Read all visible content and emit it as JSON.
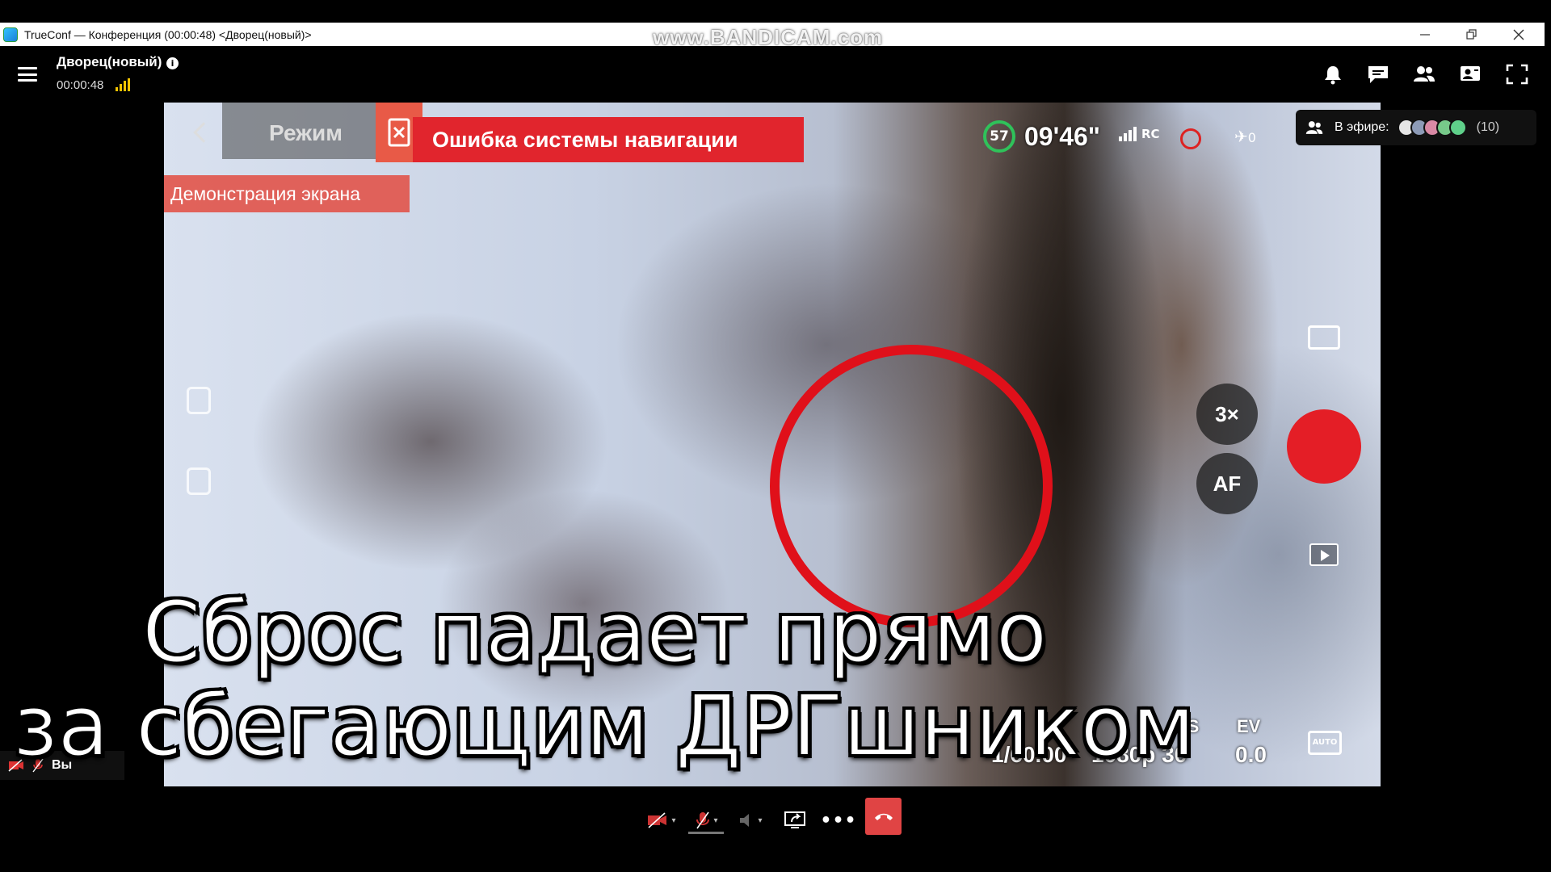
{
  "window": {
    "title": "TrueConf — Конференция (00:00:48) <Дворец(новый)>",
    "watermark": "www.BANDICAM.com"
  },
  "header": {
    "conference_name": "Дворец(новый)",
    "elapsed": "00:00:48",
    "icons": [
      "menu-icon",
      "info-icon",
      "signal-icon",
      "bell-icon",
      "chat-icon",
      "participants-icon",
      "content-icon",
      "fullscreen-icon"
    ]
  },
  "shared_screen": {
    "screen_share_label": "Демонстрация экрана",
    "mode_label": "Режим",
    "nav_error": "Ошибка системы навигации",
    "battery": "57",
    "flight_time": "09'46\"",
    "rc_label": "RC",
    "satellites": "0",
    "zoom_label": "3×",
    "af_label": "AF",
    "camera": {
      "fps_label": "PS",
      "ev_label": "EV",
      "shutter_value": "1/60.00",
      "resolution_value": "1080p 30",
      "ev_value": "0.0",
      "auto_label": "AUTO"
    },
    "colors": {
      "nav_error": "#e1252d",
      "record": "#e41e26",
      "target_circle": "#e0101a",
      "battery_ring": "#2fc25a"
    }
  },
  "on_air": {
    "label": "В эфире:",
    "count": "(10)"
  },
  "subtitles": {
    "line1": "Сброс падает прямо",
    "line2": "за сбегающим ДРГшником"
  },
  "self_view": {
    "name": "Вы"
  },
  "toolbar": {
    "hangup_color": "#e04444",
    "buttons": [
      "camera-off-button",
      "microphone-off-button",
      "speaker-button",
      "share-screen-button",
      "more-button",
      "hangup-button"
    ],
    "more_label": "•••"
  }
}
